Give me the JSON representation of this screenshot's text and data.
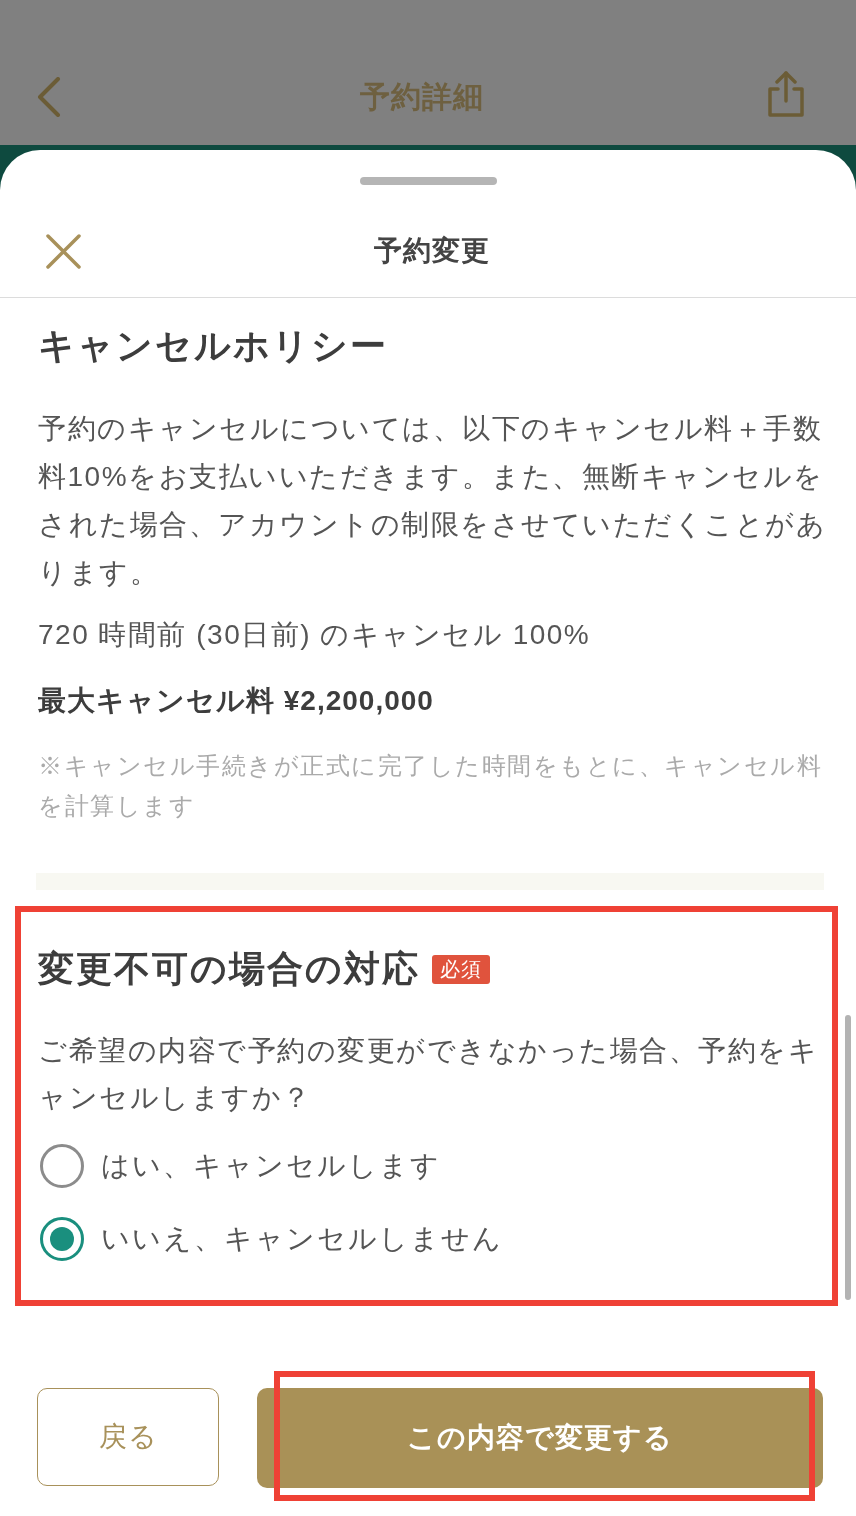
{
  "background_screen": {
    "title": "予約詳細"
  },
  "sheet": {
    "title": "予約変更"
  },
  "cancel_policy": {
    "heading": "キャンセルホリシー",
    "body": "予約のキャンセルについては、以下のキャンセル料＋手数料10%をお支払いいただきます。また、無断キャンセルをされた場合、アカウントの制限をさせていただくことがあります。",
    "rule": "720 時間前 (30日前) のキャンセル 100%",
    "max_fee": "最大キャンセル料 ¥2,200,000",
    "note": "※キャンセル手続きが正式に完了した時間をもとに、キャンセル料を計算します"
  },
  "fallback_section": {
    "heading": "変更不可の場合の対応",
    "badge": "必須",
    "highlighted": true,
    "question": "ご希望の内容で予約の変更ができなかった場合、予約をキャンセルしますか？",
    "options": [
      {
        "label": "はい、キャンセルします",
        "selected": false
      },
      {
        "label": "いいえ、キャンセルしません",
        "selected": true
      }
    ]
  },
  "buttons": [
    {
      "kind": "secondary",
      "label": "戻る",
      "highlighted": false
    },
    {
      "kind": "primary",
      "label": "この内容で変更する",
      "highlighted": true
    }
  ]
}
